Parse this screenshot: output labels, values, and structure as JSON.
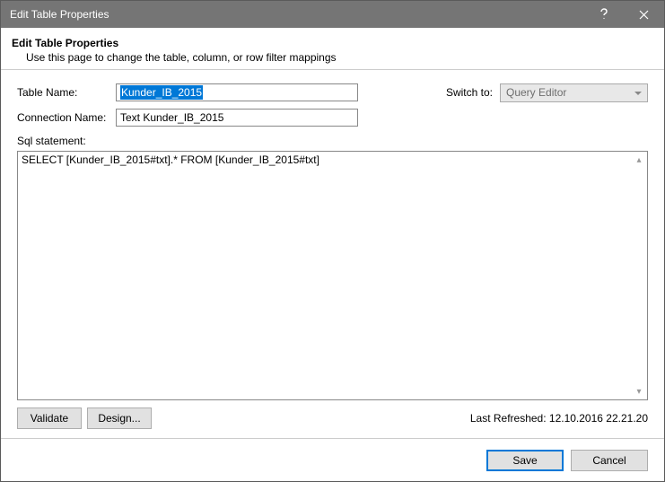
{
  "titlebar": {
    "title": "Edit Table Properties"
  },
  "header": {
    "title": "Edit Table Properties",
    "subtitle": "Use this page to change the table, column, or row filter mappings"
  },
  "form": {
    "table_name_label": "Table Name:",
    "table_name_value": "Kunder_IB_2015",
    "connection_name_label": "Connection Name:",
    "connection_name_value": "Text Kunder_IB_2015",
    "switch_to_label": "Switch to:",
    "switch_to_value": "Query Editor",
    "sql_label": "Sql statement:",
    "sql_value": "SELECT [Kunder_IB_2015#txt].*   FROM [Kunder_IB_2015#txt]"
  },
  "actions": {
    "validate": "Validate",
    "design": "Design...",
    "last_refreshed": "Last Refreshed: 12.10.2016 22.21.20",
    "save": "Save",
    "cancel": "Cancel"
  }
}
